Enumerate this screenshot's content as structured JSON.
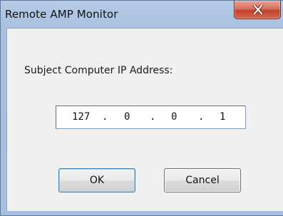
{
  "window": {
    "title": "Remote AMP Monitor"
  },
  "icons": {
    "close": "close-icon"
  },
  "dialog": {
    "label": "Subject Computer IP Address:",
    "ip_octets": [
      "127",
      "0",
      "0",
      "1"
    ],
    "separator": "."
  },
  "buttons": {
    "ok_label": "OK",
    "cancel_label": "Cancel"
  },
  "colors": {
    "close_button": "#c2412c",
    "frame": "#a7bfde",
    "client": "#f0f0f0"
  }
}
